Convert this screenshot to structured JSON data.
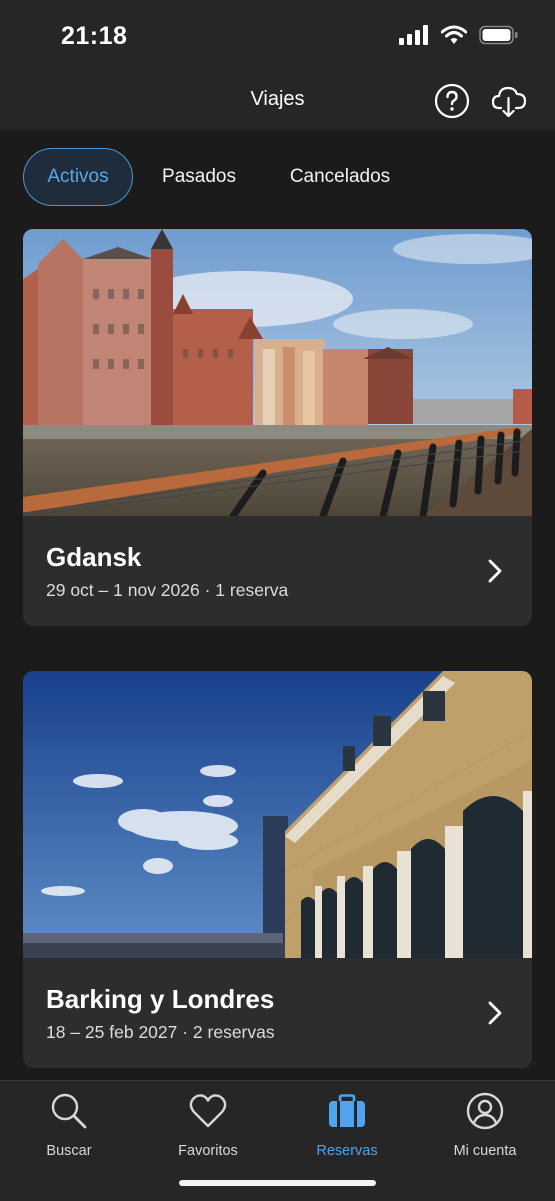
{
  "status_bar": {
    "time": "21:18"
  },
  "header": {
    "title": "Viajes",
    "help_icon": "question-circle-icon",
    "download_icon": "cloud-download-icon"
  },
  "tabs": [
    {
      "label": "Activos",
      "active": true
    },
    {
      "label": "Pasados",
      "active": false
    },
    {
      "label": "Cancelados",
      "active": false
    }
  ],
  "trips": [
    {
      "city": "Gdansk",
      "details": "29 oct – 1 nov 2026 · 1 reserva"
    },
    {
      "city": "Barking y Londres",
      "details": "18 – 25 feb 2027 · 2 reservas"
    }
  ],
  "bottom_nav": [
    {
      "label": "Buscar",
      "icon": "search-icon"
    },
    {
      "label": "Favoritos",
      "icon": "heart-icon"
    },
    {
      "label": "Reservas",
      "icon": "suitcase-icon",
      "active": true
    },
    {
      "label": "Mi cuenta",
      "icon": "user-icon"
    }
  ],
  "colors": {
    "accent": "#4fa3ef",
    "background": "#1b1b1b",
    "card": "#2d2d2d"
  }
}
